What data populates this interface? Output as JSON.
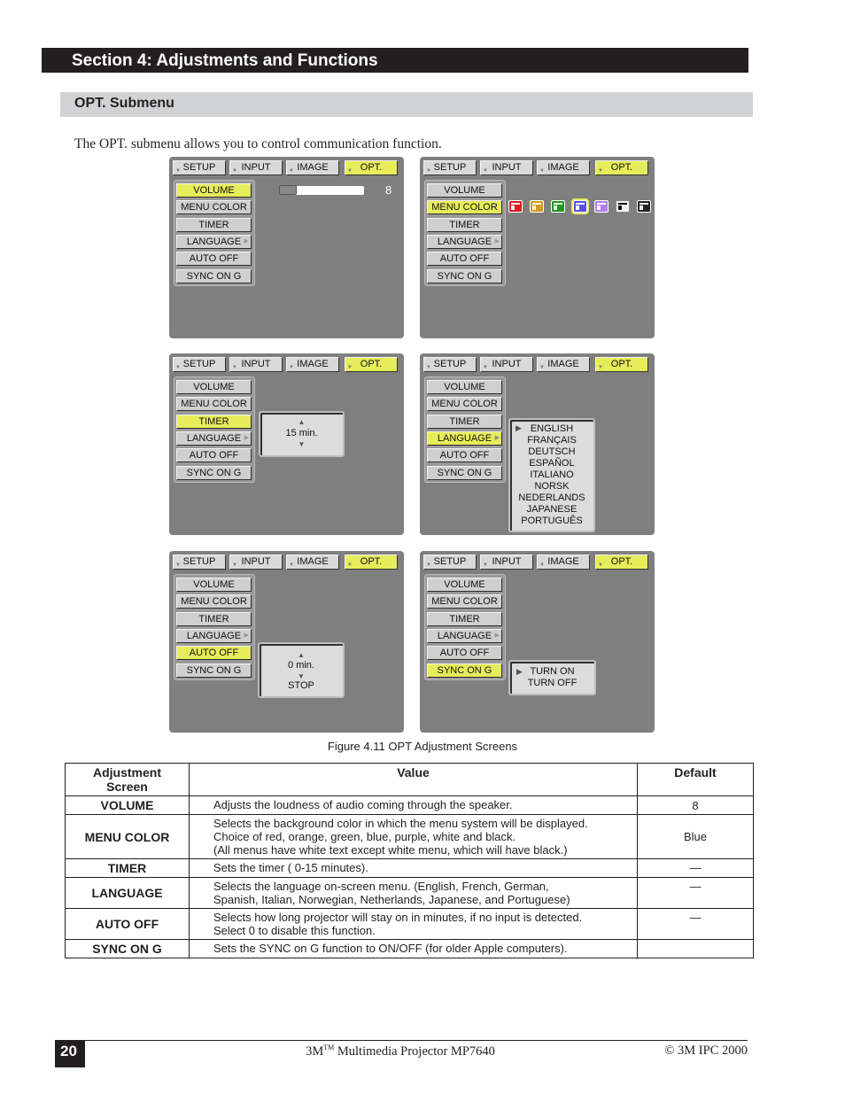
{
  "header": {
    "section_title": "Section 4: Adjustments and Functions",
    "subsection_title": "OPT. Submenu",
    "intro": "The OPT. submenu allows you to control communication function."
  },
  "osd": {
    "tabs": [
      "SETUP",
      "INPUT",
      "IMAGE",
      "OPT."
    ],
    "active_tab": "OPT.",
    "menu_items": [
      "VOLUME",
      "MENU COLOR",
      "TIMER",
      "LANGUAGE",
      "AUTO OFF",
      "SYNC ON G"
    ],
    "highlight_color": "#e6ec5a",
    "screens": {
      "volume": {
        "selected": "VOLUME",
        "value": "8",
        "level_fraction": 0.12
      },
      "menu_color": {
        "selected": "MENU COLOR",
        "swatches": [
          {
            "name": "red",
            "color": "#d42020"
          },
          {
            "name": "orange",
            "color": "#d49a20"
          },
          {
            "name": "green",
            "color": "#1f9a1f"
          },
          {
            "name": "blue",
            "color": "#5a4ee8"
          },
          {
            "name": "purple",
            "color": "#b07ef0"
          },
          {
            "name": "white",
            "color": "#f2f2f2"
          },
          {
            "name": "black",
            "color": "#222222"
          }
        ],
        "selected_swatch": "blue"
      },
      "timer": {
        "selected": "TIMER",
        "value": "15 min."
      },
      "language": {
        "selected": "LANGUAGE",
        "options": [
          "ENGLISH",
          "FRANÇAIS",
          "DEUTSCH",
          "ESPAÑOL",
          "ITALIANO",
          "NORSK",
          "NEDERLANDS",
          "JAPANESE",
          "PORTUGUÊS"
        ],
        "current": "ENGLISH"
      },
      "auto_off": {
        "selected": "AUTO OFF",
        "value": "0 min.",
        "status": "STOP"
      },
      "sync_on_g": {
        "selected": "SYNC ON G",
        "options": [
          "TURN ON",
          "TURN OFF"
        ],
        "current": "TURN ON"
      }
    }
  },
  "figure_caption": "Figure 4.11 OPT Adjustment Screens",
  "table": {
    "headers": [
      "Adjustment Screen",
      "Value",
      "Default"
    ],
    "rows": [
      {
        "screen": "VOLUME",
        "value": [
          "Adjusts the loudness of audio coming through the speaker."
        ],
        "default": "8"
      },
      {
        "screen": "MENU COLOR",
        "value": [
          "Selects the background color in which the menu system will be displayed.",
          "Choice of red, orange, green, blue, purple, white and black.",
          "(All menus have white text except white menu, which will have black.)"
        ],
        "default": "Blue"
      },
      {
        "screen": "TIMER",
        "value": [
          "Sets the timer ( 0-15 minutes)."
        ],
        "default": "—"
      },
      {
        "screen": "LANGUAGE",
        "value": [
          "Selects the language on-screen menu. (English, French, German,",
          "Spanish, Italian, Norwegian, Netherlands, Japanese, and Portuguese)"
        ],
        "default": "—"
      },
      {
        "screen": "AUTO OFF",
        "value": [
          "Selects how long projector will stay on in minutes, if no input is detected.",
          "Select 0 to disable this function."
        ],
        "default": "—"
      },
      {
        "screen": "SYNC ON G",
        "value": [
          "Sets the SYNC on G function to ON/OFF (for older Apple computers)."
        ],
        "default": ""
      }
    ]
  },
  "footer": {
    "page_number": "20",
    "brand": "3M",
    "tm": "TM",
    "product": " Multimedia Projector MP7640",
    "copyright": "© 3M IPC 2000"
  }
}
